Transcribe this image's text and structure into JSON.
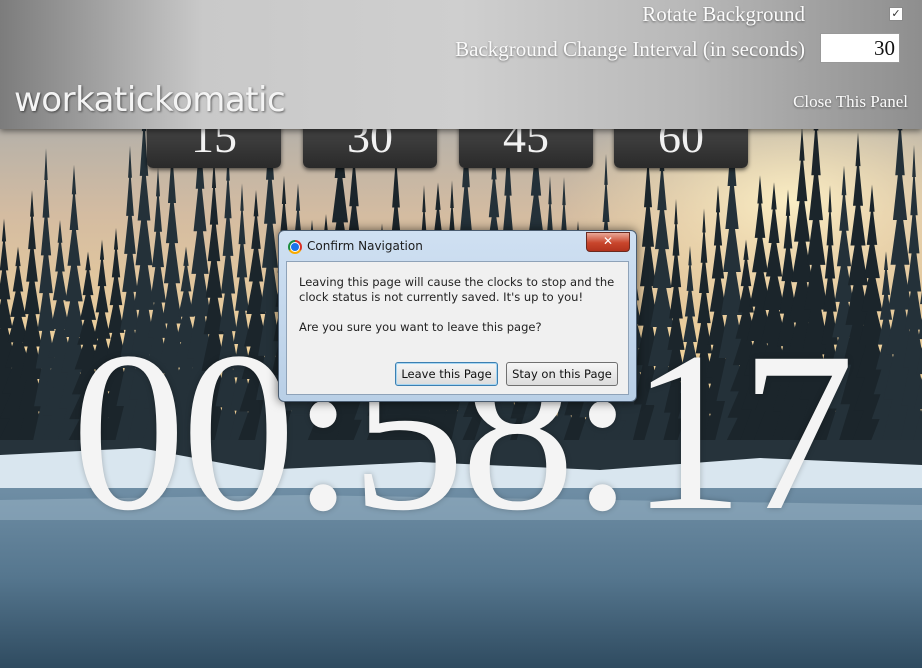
{
  "panel": {
    "rotate_label": "Rotate Background",
    "rotate_checked": true,
    "rotate_check_mark": "✓",
    "interval_label": "Background Change Interval (in seconds)",
    "interval_value": "30",
    "logo": "workatickomatic",
    "close_label": "Close This Panel"
  },
  "tabs": [
    "15",
    "30",
    "45",
    "60"
  ],
  "clock": {
    "time": "00:58:17"
  },
  "dialog": {
    "title": "Confirm Navigation",
    "close_icon": "close-icon",
    "message_1": "Leaving this page will cause the clocks to stop and the clock status is not currently saved. It's up to you!",
    "message_2": "Are you sure you want to leave this page?",
    "leave_label": "Leave this Page",
    "stay_label": "Stay on this Page"
  },
  "colors": {
    "sky": "#c9a98a",
    "water": "#5f7f96",
    "snow": "#d7e4ee",
    "forest": "#1f2a30"
  }
}
